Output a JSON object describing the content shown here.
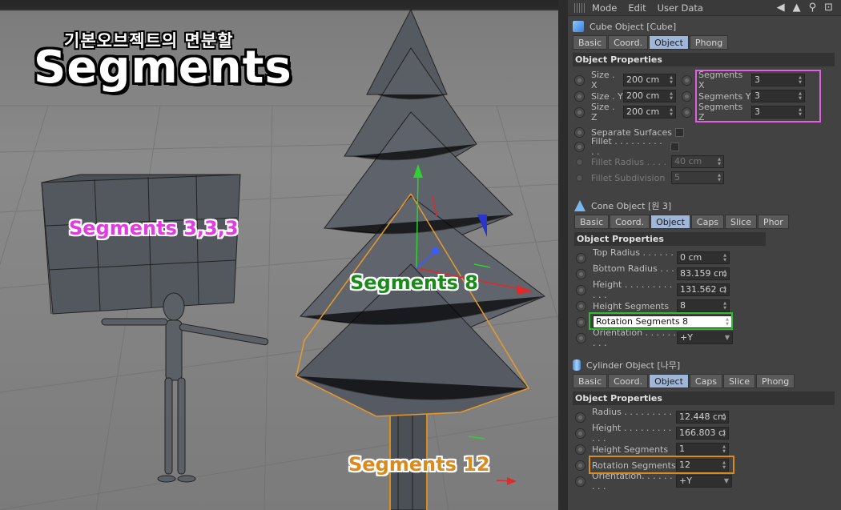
{
  "viewport": {
    "title_korean": "기본오브젝트의 면분할",
    "title": "Segments",
    "labels": {
      "cube": "Segments 3,3,3",
      "cone": "Segments 8",
      "cylinder": "Segments 12"
    },
    "colors": {
      "cube": "#e03ce0",
      "cone": "#1a8a1a",
      "cylinder": "#d98b1c"
    }
  },
  "panel": {
    "menu": [
      "Mode",
      "Edit",
      "User Data"
    ],
    "tool_icons": [
      "back-arrow-icon",
      "cursor-icon",
      "search-icon",
      "lock-icon"
    ],
    "cube": {
      "header": "Cube Object [Cube]",
      "tabs": [
        "Basic",
        "Coord.",
        "Object",
        "Phong"
      ],
      "active_tab": "Object",
      "section": "Object Properties",
      "size": [
        {
          "label": "Size . X",
          "value": "200 cm"
        },
        {
          "label": "Size . Y",
          "value": "200 cm"
        },
        {
          "label": "Size . Z",
          "value": "200 cm"
        }
      ],
      "segments": [
        {
          "label": "Segments X",
          "value": "3"
        },
        {
          "label": "Segments Y",
          "value": "3"
        },
        {
          "label": "Segments Z",
          "value": "3"
        }
      ],
      "separate_surfaces": "Separate Surfaces",
      "fillet": "Fillet . . . . . . . . . . .",
      "fillet_radius": {
        "label": "Fillet Radius . . . .",
        "value": "40 cm"
      },
      "fillet_subdivision": {
        "label": "Fillet Subdivision",
        "value": "5"
      }
    },
    "cone": {
      "header": "Cone Object [원 3]",
      "tabs": [
        "Basic",
        "Coord.",
        "Object",
        "Caps",
        "Slice",
        "Phor"
      ],
      "active_tab": "Object",
      "section": "Object Properties",
      "rows": [
        {
          "label": "Top Radius . . . . . . . .",
          "value": "0 cm"
        },
        {
          "label": "Bottom Radius . . . . .",
          "value": "83.159 cm"
        },
        {
          "label": "Height . . . . . . . . . . . .",
          "value": "131.562 cı"
        },
        {
          "label": "Height Segments",
          "value": "8"
        },
        {
          "label": "Rotation Segments",
          "value": "8"
        },
        {
          "label": "Orientation . . . . . . . . .",
          "value": "+Y"
        }
      ]
    },
    "cylinder": {
      "header": "Cylinder Object [나무]",
      "tabs": [
        "Basic",
        "Coord.",
        "Object",
        "Caps",
        "Slice",
        "Phong"
      ],
      "active_tab": "Object",
      "section": "Object Properties",
      "rows": [
        {
          "label": "Radius . . . . . . . . . . .",
          "value": "12.448 cm"
        },
        {
          "label": "Height . . . . . . . . . . . .",
          "value": "166.803 cı"
        },
        {
          "label": "Height Segments",
          "value": "1"
        },
        {
          "label": "Rotation Segments",
          "value": "12"
        },
        {
          "label": "Orientation. . . . . . . . .",
          "value": "+Y"
        }
      ]
    }
  }
}
